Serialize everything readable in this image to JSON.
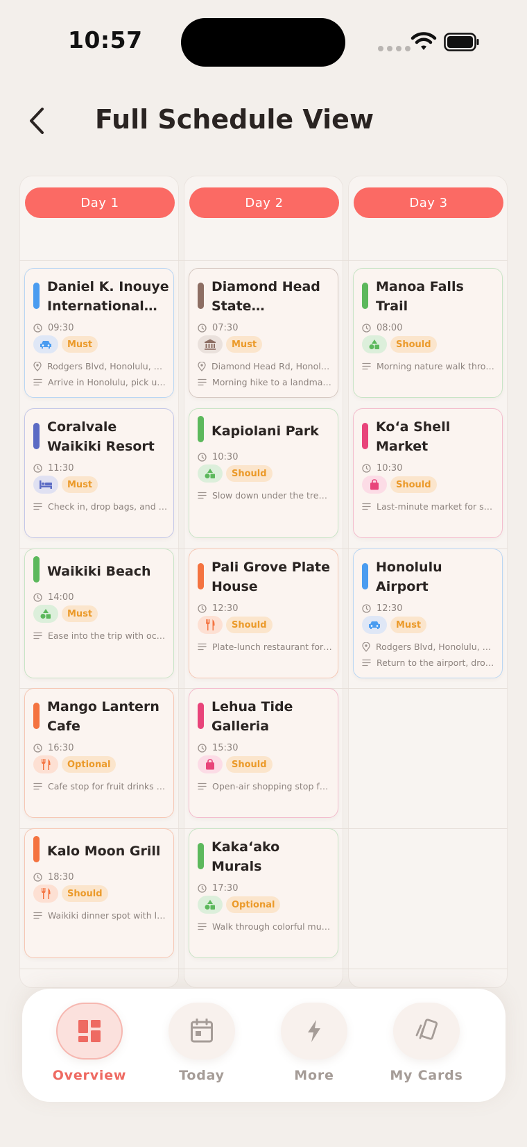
{
  "status": {
    "time": "10:57"
  },
  "header": {
    "title": "Full Schedule View"
  },
  "days": [
    {
      "label": "Day 1"
    },
    {
      "label": "Day 2"
    },
    {
      "label": "Day 3"
    }
  ],
  "cards": [
    {
      "title": "Daniel K. Inouye International A...",
      "time": "09:30",
      "priority": "Must",
      "address": "Rodgers Blvd, Honolulu, H...",
      "note": "Arrive in Honolulu, pick up...",
      "category_icon": "car-icon",
      "color": "#4a9cf0"
    },
    {
      "title": "Coralvale Waikiki Resort",
      "time": "11:30",
      "priority": "Must",
      "note": "Check in, drop bags, and r...",
      "category_icon": "bed-icon",
      "color": "#5b6bc4"
    },
    {
      "title": "Waikiki Beach",
      "time": "14:00",
      "priority": "Must",
      "note": "Ease into the trip with oce...",
      "category_icon": "nature-icon",
      "color": "#5cb85c"
    },
    {
      "title": "Mango Lantern Cafe",
      "time": "16:30",
      "priority": "Optional",
      "note": "Cafe stop for fruit drinks a...",
      "category_icon": "fork-knife-icon",
      "color": "#f47340"
    },
    {
      "title": "Kalo Moon Grill",
      "time": "18:30",
      "priority": "Should",
      "note": "Waikiki dinner spot with liv...",
      "category_icon": "fork-knife-icon",
      "color": "#f47340"
    },
    {
      "title": "Diamond Head State Monument",
      "time": "07:30",
      "priority": "Must",
      "address": "Diamond Head Rd, Honolu...",
      "note": "Morning hike to a landmar...",
      "category_icon": "landmark-icon",
      "color": "#8d6e63"
    },
    {
      "title": "Kapiolani Park",
      "time": "10:30",
      "priority": "Should",
      "note": "Slow down under the trees...",
      "category_icon": "nature-icon",
      "color": "#5cb85c"
    },
    {
      "title": "Pali Grove Plate House",
      "time": "12:30",
      "priority": "Should",
      "note": "Plate-lunch restaurant for ...",
      "category_icon": "fork-knife-icon",
      "color": "#f47340"
    },
    {
      "title": "Lehua Tide Galleria",
      "time": "15:30",
      "priority": "Should",
      "note": "Open-air shopping stop fo...",
      "category_icon": "shopping-bag-icon",
      "color": "#e8447a"
    },
    {
      "title": "Kakaʻako Murals",
      "time": "17:30",
      "priority": "Optional",
      "note": "Walk through colorful mur...",
      "category_icon": "nature-icon",
      "color": "#5cb85c"
    },
    {
      "title": "Manoa Falls Trail",
      "time": "08:00",
      "priority": "Should",
      "note": "Morning nature walk throu...",
      "category_icon": "nature-icon",
      "color": "#5cb85c"
    },
    {
      "title": "Koʻa Shell Market",
      "time": "10:30",
      "priority": "Should",
      "note": "Last-minute market for sm...",
      "category_icon": "shopping-bag-icon",
      "color": "#e8447a"
    },
    {
      "title": "Honolulu Airport",
      "time": "12:30",
      "priority": "Must",
      "address": "Rodgers Blvd, Honolulu, H...",
      "note": "Return to the airport, drop...",
      "category_icon": "car-icon",
      "color": "#4a9cf0"
    }
  ],
  "nav": {
    "items": [
      {
        "label": "Overview",
        "icon": "dashboard-icon"
      },
      {
        "label": "Today",
        "icon": "calendar-icon"
      },
      {
        "label": "More",
        "icon": "lightning-icon"
      },
      {
        "label": "My Cards",
        "icon": "cards-icon"
      }
    ]
  }
}
